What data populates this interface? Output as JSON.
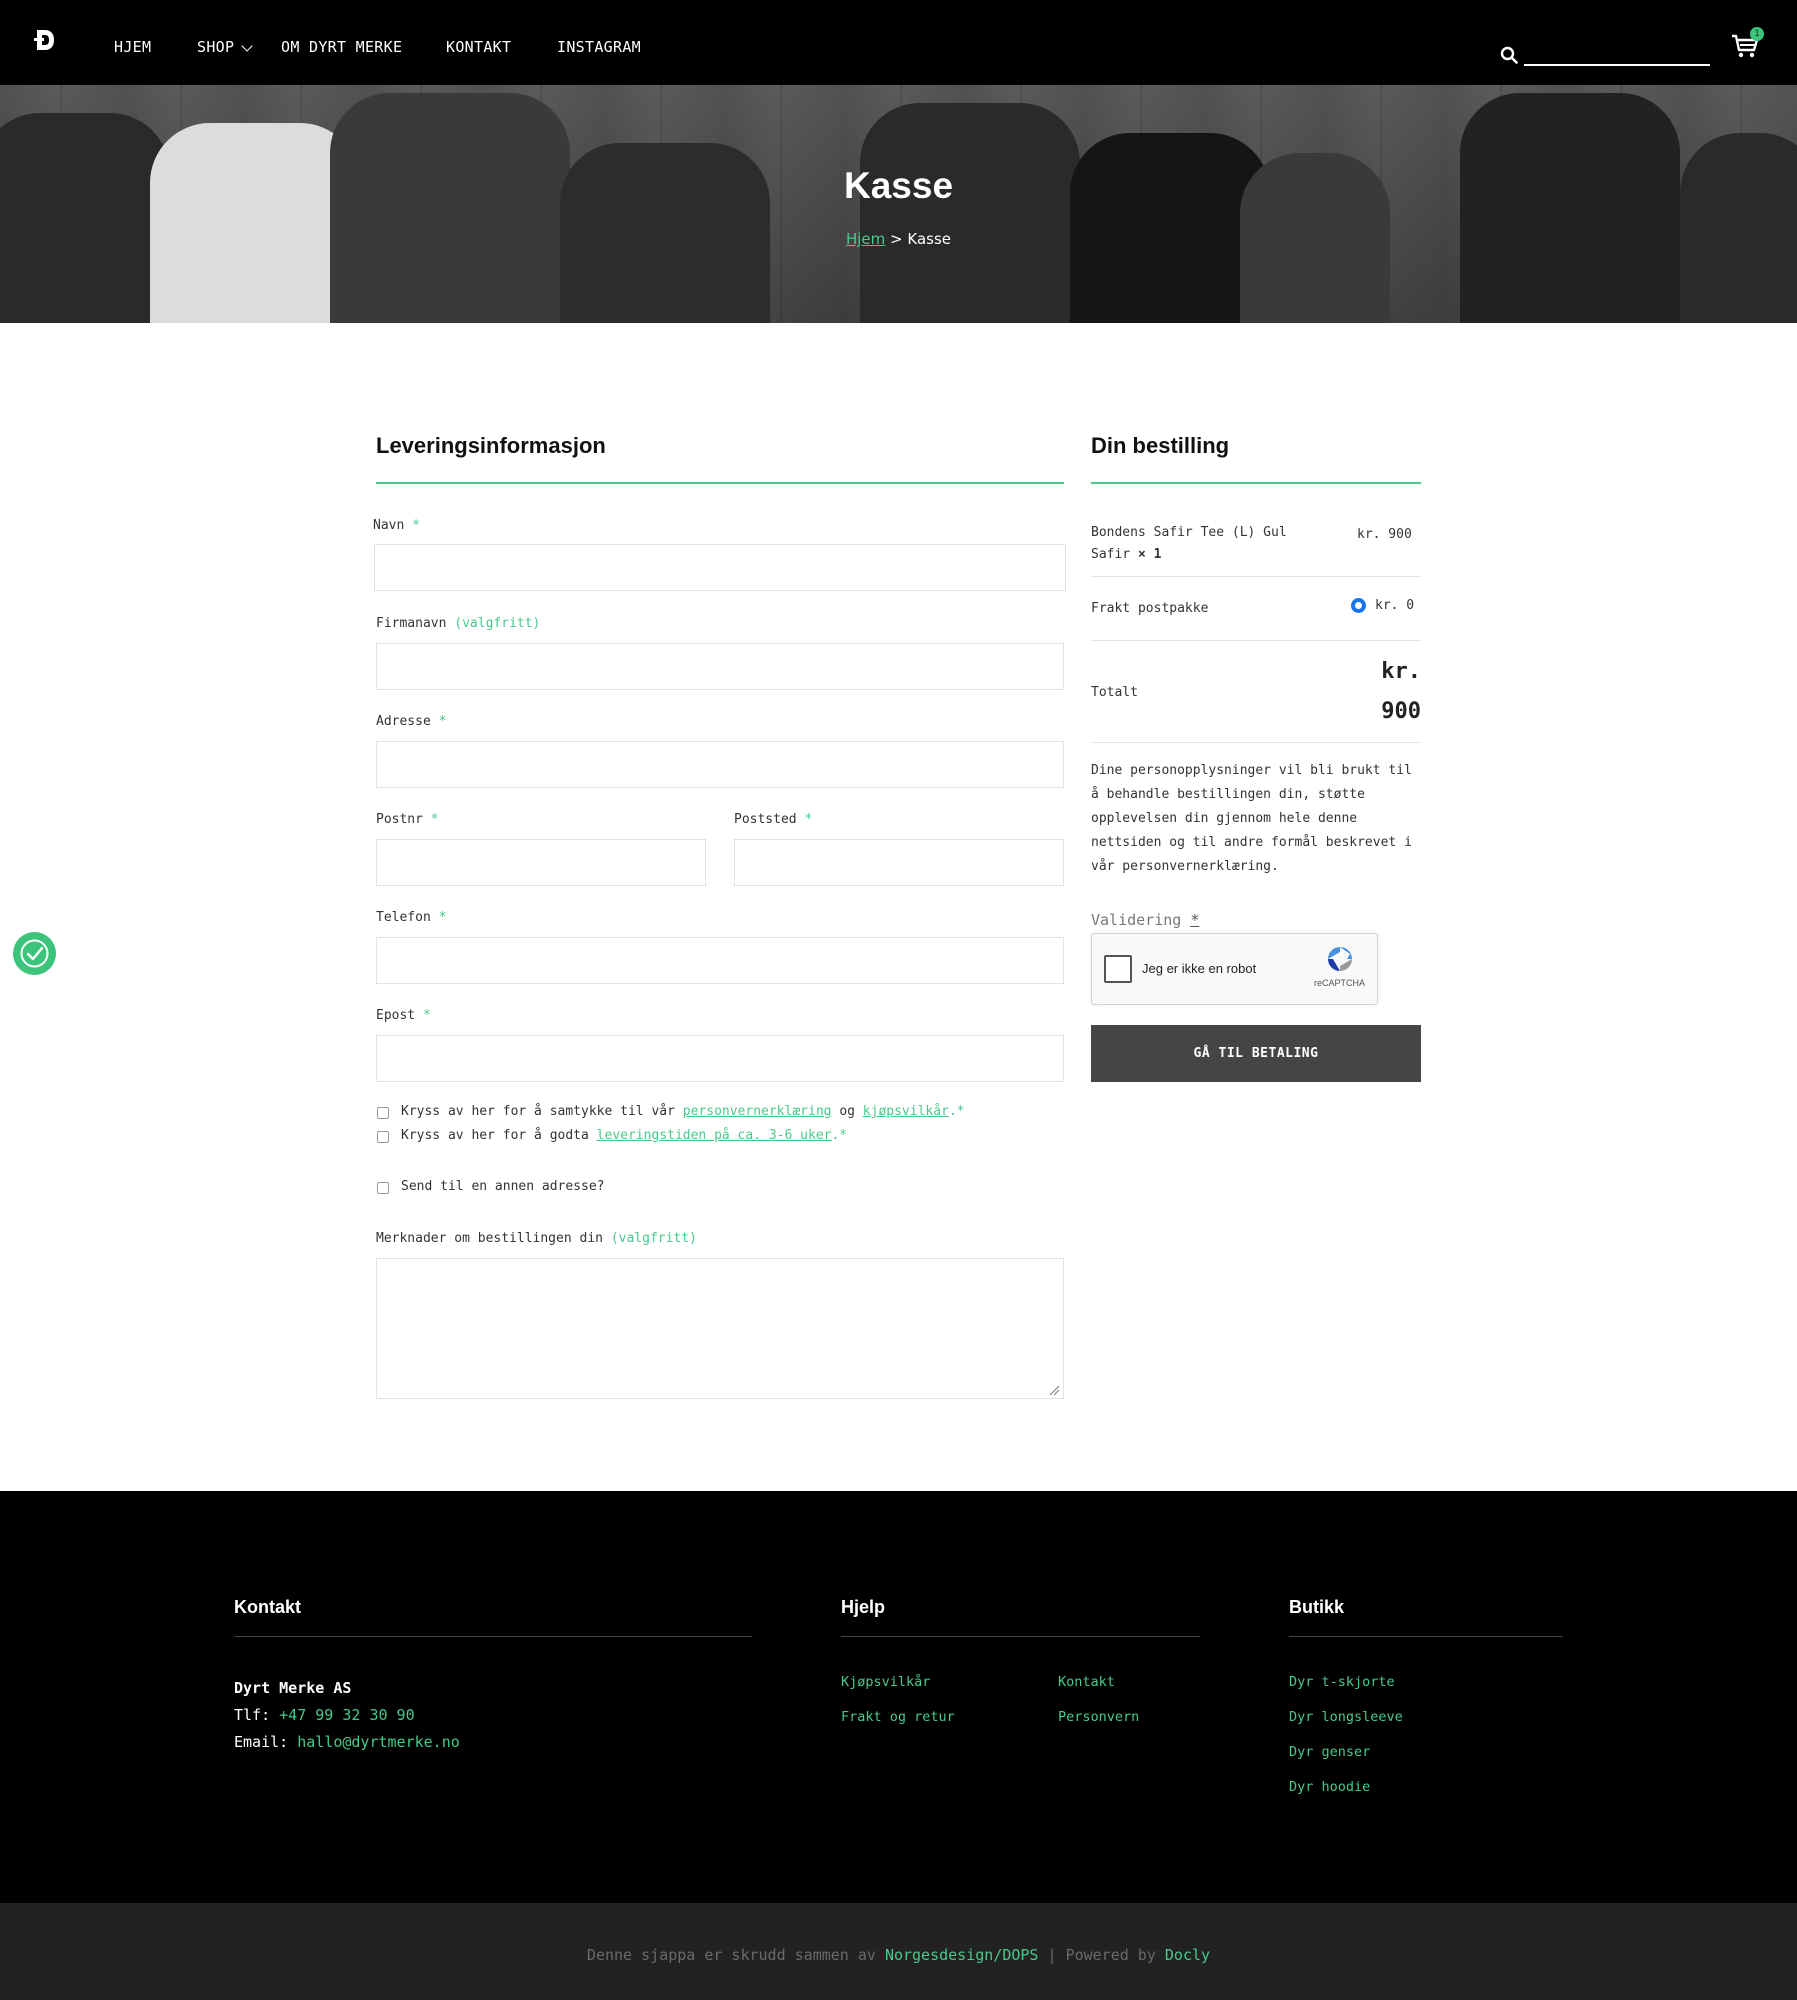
{
  "header": {
    "nav": {
      "home": "HJEM",
      "shop": "SHOP",
      "about": "OM DYRT MERKE",
      "contact": "KONTAKT",
      "instagram": "INSTAGRAM"
    },
    "search_value": "",
    "cart_count": "1"
  },
  "hero": {
    "title": "Kasse",
    "breadcrumb_home": "Hjem",
    "breadcrumb_sep": ">",
    "breadcrumb_current": "Kasse"
  },
  "form": {
    "title": "Leveringsinformasjon",
    "required_mark": "*",
    "optional_text": "(valgfritt)",
    "name_label": "Navn",
    "company_label": "Firmanavn",
    "address_label": "Adresse",
    "postcode_label": "Postnr",
    "city_label": "Poststed",
    "phone_label": "Telefon",
    "email_label": "Epost",
    "consent": {
      "prefix": "Kryss av her for å samtykke til vår",
      "privacy_link": "personvernerklæring",
      "and": "og",
      "terms_link": "kjøpsvilkår",
      "suffix": ".*"
    },
    "delivery": {
      "prefix": "Kryss av her for å godta",
      "link": "leveringstiden på ca. 3-6 uker",
      "suffix": ".*"
    },
    "ship_other_label": "Send til en annen adresse?",
    "notes_label": "Merknader om bestillingen din"
  },
  "order": {
    "title": "Din bestilling",
    "item_name_line1": "Bondens Safir Tee (L) Gul",
    "item_name_line2": "Safir",
    "item_qty": "× 1",
    "item_price": "kr. 900",
    "shipping_label": "Frakt postpakke",
    "shipping_price": "kr. 0",
    "total_label": "Totalt",
    "total_currency": "kr.",
    "total_value": "900",
    "privacy_text": "Dine personopplysninger vil bli brukt til å behandle bestillingen din, støtte opplevelsen din gjennom hele denne nettsiden og til andre formål beskrevet i vår personvernerklæring.",
    "validation_label": "Validering",
    "validation_req": "*",
    "recaptcha_label": "Jeg er ikke en robot",
    "recaptcha_brand": "reCAPTCHA",
    "pay_button": "GÅ TIL BETALING"
  },
  "footer": {
    "contact_title": "Kontakt",
    "company": "Dyrt Merke AS",
    "phone_label": "Tlf:",
    "phone": "+47 99 32 30 90",
    "email_label": "Email:",
    "email": "hallo@dyrtmerke.no",
    "help_title": "Hjelp",
    "help_links": [
      "Kjøpsvilkår",
      "Frakt og retur",
      "Kontakt",
      "Personvern"
    ],
    "shop_title": "Butikk",
    "shop_links": [
      "Dyr t-skjorte",
      "Dyr longsleeve",
      "Dyr genser",
      "Dyr hoodie"
    ],
    "credit_prefix": "Denne sjappa er skrudd sammen av",
    "credit_design": "Norgesdesign",
    "credit_slash": "/",
    "credit_dops": "DOPS",
    "credit_sep": "|",
    "credit_powered": "Powered by",
    "credit_docly": "Docly"
  },
  "colors": {
    "accent": "#48c98c",
    "header_bg": "#000000",
    "button_bg": "#454545",
    "bottom_bar": "#222222"
  }
}
